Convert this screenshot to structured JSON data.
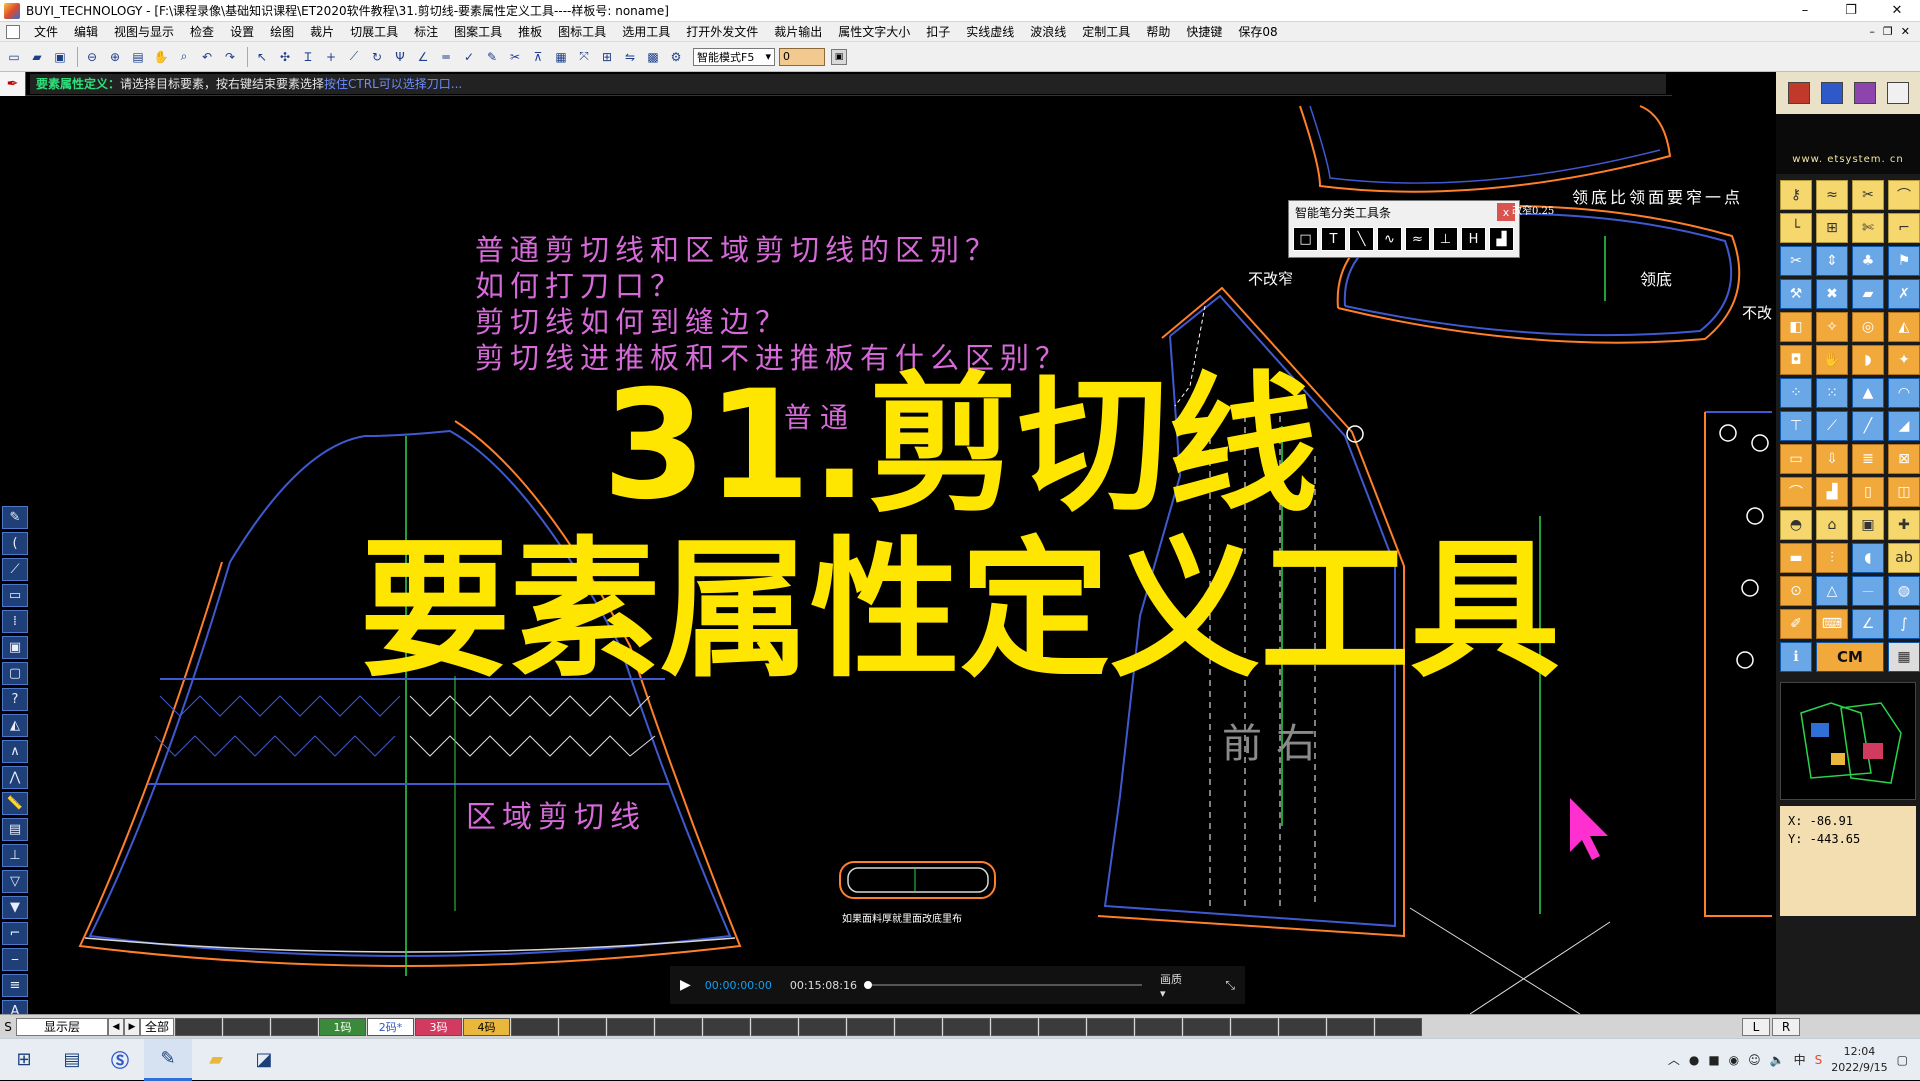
{
  "window": {
    "title": "BUYI_TECHNOLOGY - [F:\\课程录像\\基础知识课程\\ET2020软件教程\\31.剪切线-要素属性定义工具----样板号: noname]",
    "minimize": "–",
    "maximize": "❐",
    "close": "✕"
  },
  "menu": {
    "items": [
      "文件",
      "编辑",
      "视图与显示",
      "检查",
      "设置",
      "绘图",
      "裁片",
      "切展工具",
      "标注",
      "图案工具",
      "推板",
      "图标工具",
      "选用工具",
      "打开外发文件",
      "裁片输出",
      "属性文字大小",
      "扣子",
      "实线虚线",
      "波浪线",
      "定制工具",
      "帮助",
      "快捷键",
      "保存08"
    ],
    "mdi_minimize": "–",
    "mdi_restore": "❐",
    "mdi_close": "✕"
  },
  "toolbar": {
    "mode_select": "智能模式F5",
    "number_value": "0"
  },
  "prompt": {
    "label": "要素属性定义：",
    "text": "请选择目标要素，按右键结束要素选择",
    "accent": "按住CTRL可以选择刀口..."
  },
  "pen_panel": {
    "title": "智能笔分类工具条",
    "close": "x",
    "tools": [
      "□",
      "T",
      "╲",
      "∿",
      "≈",
      "⊥",
      "H",
      "▟"
    ]
  },
  "canvas": {
    "questions": [
      "普通剪切线和区域剪切线的区别？",
      "如何打刀口？",
      "剪切线如何到缝边？",
      "剪切线进推板和不进推板有什么区别？"
    ],
    "headline_line1": "31.剪切线",
    "headline_line2": "要素属性定义工具",
    "label_normal": "普通",
    "label_region": "区域剪切线",
    "label_front_right": "前右",
    "label_collar_note": "领底比领面要窄一点",
    "label_collar_base": "领底",
    "label_no_narrow": "不改窄",
    "label_no_change_right": "不改",
    "label_narrow_value": "改窄0.25",
    "label_fabric_note": "如果面料厚就里面改底里布"
  },
  "player": {
    "current": "00:00:00:00",
    "total": "00:15:08:16",
    "quality": "画质 ▾"
  },
  "right_panel": {
    "website": "www. etsystem. cn",
    "cm_label": "CM",
    "coord_x": "X:  -86.91",
    "coord_y": "Y:  -443.65"
  },
  "layerbar": {
    "s_label": "S",
    "layer_select": "显示层",
    "all_label": "全部",
    "sizes": [
      "1码",
      "2码*",
      "3码",
      "4码"
    ],
    "size_colors": [
      "#3b8a3b",
      "#ffffff",
      "#d23b5f",
      "#e8b73b"
    ],
    "left": "L",
    "right": "R"
  },
  "taskbar": {
    "time": "12:04",
    "date": "2022/9/15"
  }
}
